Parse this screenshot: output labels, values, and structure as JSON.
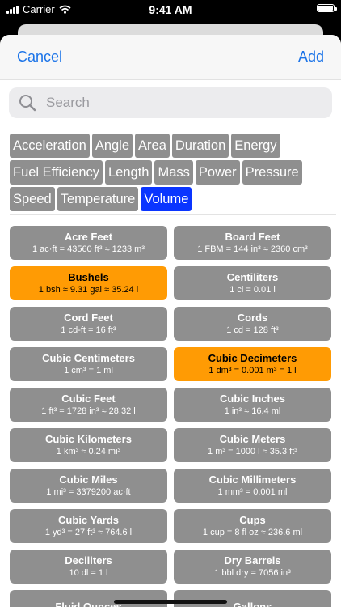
{
  "status_bar": {
    "carrier": "Carrier",
    "time": "9:41 AM"
  },
  "nav": {
    "cancel_label": "Cancel",
    "add_label": "Add"
  },
  "search": {
    "placeholder": "Search"
  },
  "categories": [
    "Acceleration",
    "Angle",
    "Area",
    "Duration",
    "Energy",
    "Fuel Efficiency",
    "Length",
    "Mass",
    "Power",
    "Pressure",
    "Speed",
    "Temperature",
    "Volume"
  ],
  "selected_category": "Volume",
  "units": [
    {
      "name": "Acre Feet",
      "desc": "1 ac·ft = 43560 ft³ ≈ 1233 m³"
    },
    {
      "name": "Board Feet",
      "desc": "1 FBM = 144 in³ ≈ 2360 cm³"
    },
    {
      "name": "Bushels",
      "desc": "1 bsh ≈ 9.31 gal ≈ 35.24 l",
      "selected": true
    },
    {
      "name": "Centiliters",
      "desc": "1 cl = 0.01 l"
    },
    {
      "name": "Cord Feet",
      "desc": "1 cd-ft = 16 ft³"
    },
    {
      "name": "Cords",
      "desc": "1 cd = 128 ft³"
    },
    {
      "name": "Cubic Centimeters",
      "desc": "1 cm³ = 1 ml"
    },
    {
      "name": "Cubic Decimeters",
      "desc": "1 dm³ = 0.001 m³ = 1 l",
      "selected": true
    },
    {
      "name": "Cubic Feet",
      "desc": "1 ft³ = 1728 in³ ≈ 28.32 l"
    },
    {
      "name": "Cubic Inches",
      "desc": "1 in³ ≈ 16.4 ml"
    },
    {
      "name": "Cubic Kilometers",
      "desc": "1 km³ ≈ 0.24 mi³"
    },
    {
      "name": "Cubic Meters",
      "desc": "1 m³ = 1000 l ≈ 35.3 ft³"
    },
    {
      "name": "Cubic Miles",
      "desc": "1 mi³ = 3379200 ac·ft"
    },
    {
      "name": "Cubic Millimeters",
      "desc": "1 mm³ = 0.001 ml"
    },
    {
      "name": "Cubic Yards",
      "desc": "1 yd³ = 27 ft³ ≈ 764.6 l"
    },
    {
      "name": "Cups",
      "desc": "1 cup = 8 fl oz ≈ 236.6 ml"
    },
    {
      "name": "Deciliters",
      "desc": "10 dl = 1 l"
    },
    {
      "name": "Dry Barrels",
      "desc": "1 bbl dry = 7056 in³"
    },
    {
      "name": "Fluid Ounces",
      "desc": ""
    },
    {
      "name": "Gallons",
      "desc": ""
    }
  ],
  "colors": {
    "accent": "#1a73e8",
    "chip": "#8f8f8f",
    "chip_selected": "#0a35ff",
    "unit_selected": "#ff9b04"
  }
}
